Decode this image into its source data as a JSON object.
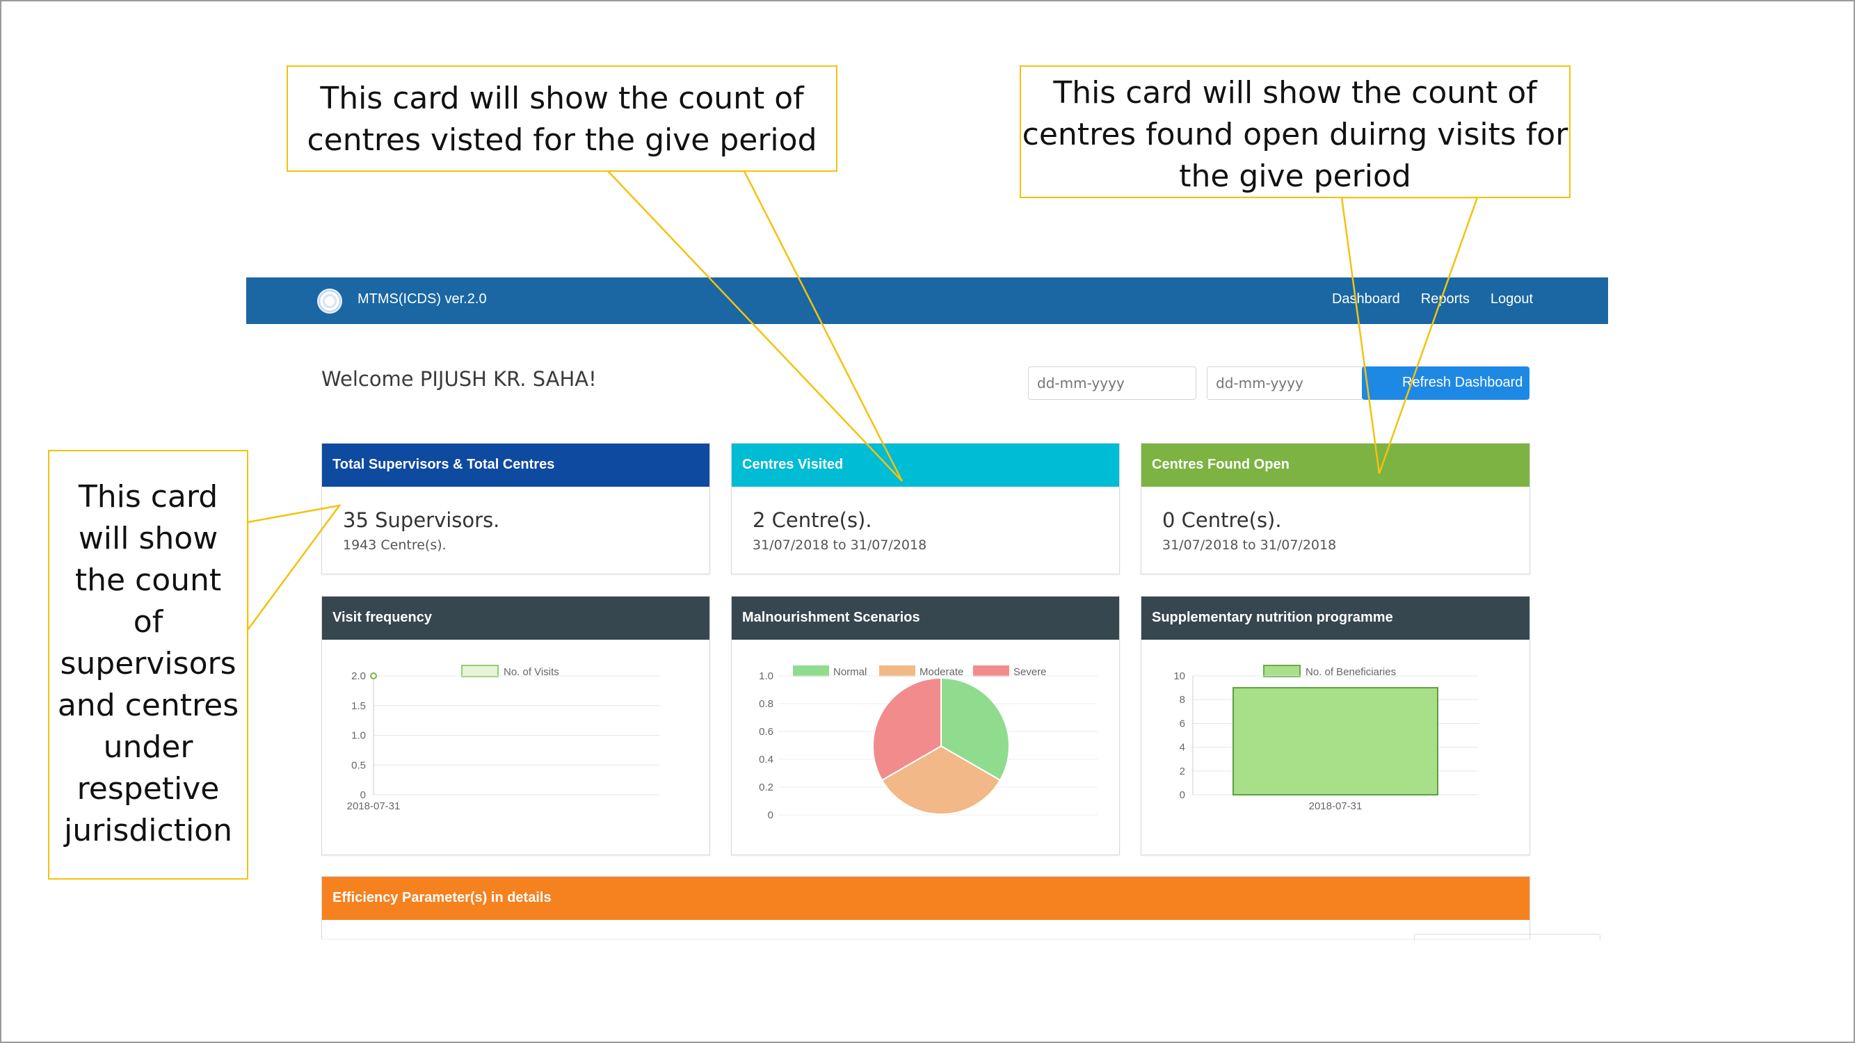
{
  "app": {
    "title": "MTMS(ICDS) ver.2.0",
    "nav_links": [
      "Dashboard",
      "Reports",
      "Logout"
    ]
  },
  "welcome": "Welcome PIJUSH KR. SAHA!",
  "date_from_placeholder": "dd-mm-yyyy",
  "date_to_placeholder": "dd-mm-yyyy",
  "refresh_button": "Refresh Dashboard",
  "cards": {
    "supervisors": {
      "title": "Total Supervisors & Total Centres",
      "count": "35 Supervisors.",
      "sub": "1943 Centre(s).",
      "color": "#0e4a9f"
    },
    "visited": {
      "title": "Centres Visited",
      "count": "2 Centre(s).",
      "sub": "31/07/2018 to 31/07/2018",
      "color": "#00bcd4"
    },
    "open": {
      "title": "Centres Found Open",
      "count": "0 Centre(s).",
      "sub": "31/07/2018 to 31/07/2018",
      "color": "#7cb342"
    },
    "visit_frequency": {
      "title": "Visit frequency",
      "color": "#37474f"
    },
    "malnourishment": {
      "title": "Malnourishment Scenarios",
      "color": "#37474f"
    },
    "supplementary": {
      "title": "Supplementary nutrition programme",
      "color": "#37474f"
    },
    "efficiency": {
      "title": "Efficiency Parameter(s) in details",
      "color": "#f5821f"
    }
  },
  "chart_data": [
    {
      "type": "line",
      "legend": [
        "No. of Visits"
      ],
      "x": [
        "2018-07-31"
      ],
      "series": [
        {
          "name": "No. of Visits",
          "values": [
            2
          ]
        }
      ],
      "y_ticks": [
        "0",
        "0.5",
        "1.0",
        "1.5",
        "2.0"
      ],
      "ylim": [
        0,
        2
      ],
      "color": "#9ccc65"
    },
    {
      "type": "pie",
      "legend": [
        "Normal",
        "Moderate",
        "Severe"
      ],
      "values": [
        1,
        1,
        1
      ],
      "y_ticks": [
        "0",
        "0.2",
        "0.4",
        "0.6",
        "0.8",
        "1.0"
      ],
      "colors": [
        "#8fdc8f",
        "#f2b887",
        "#f28b8b"
      ]
    },
    {
      "type": "bar",
      "legend": [
        "No. of Beneficiaries"
      ],
      "categories": [
        "2018-07-31"
      ],
      "values": [
        9
      ],
      "y_ticks": [
        "0",
        "2",
        "4",
        "6",
        "8",
        "10"
      ],
      "ylim": [
        0,
        10
      ],
      "color": "#a8e08a"
    }
  ],
  "annotations": {
    "left": [
      "This card",
      "will show",
      "the count",
      "of",
      "supervisors",
      "and centres",
      "under",
      "respetive",
      "jurisdiction"
    ],
    "middle": [
      "This card will show the count of",
      "centres visted for the give period"
    ],
    "right": [
      "This card will show the count of",
      "centres found open duirng visits for",
      "the give period"
    ]
  }
}
